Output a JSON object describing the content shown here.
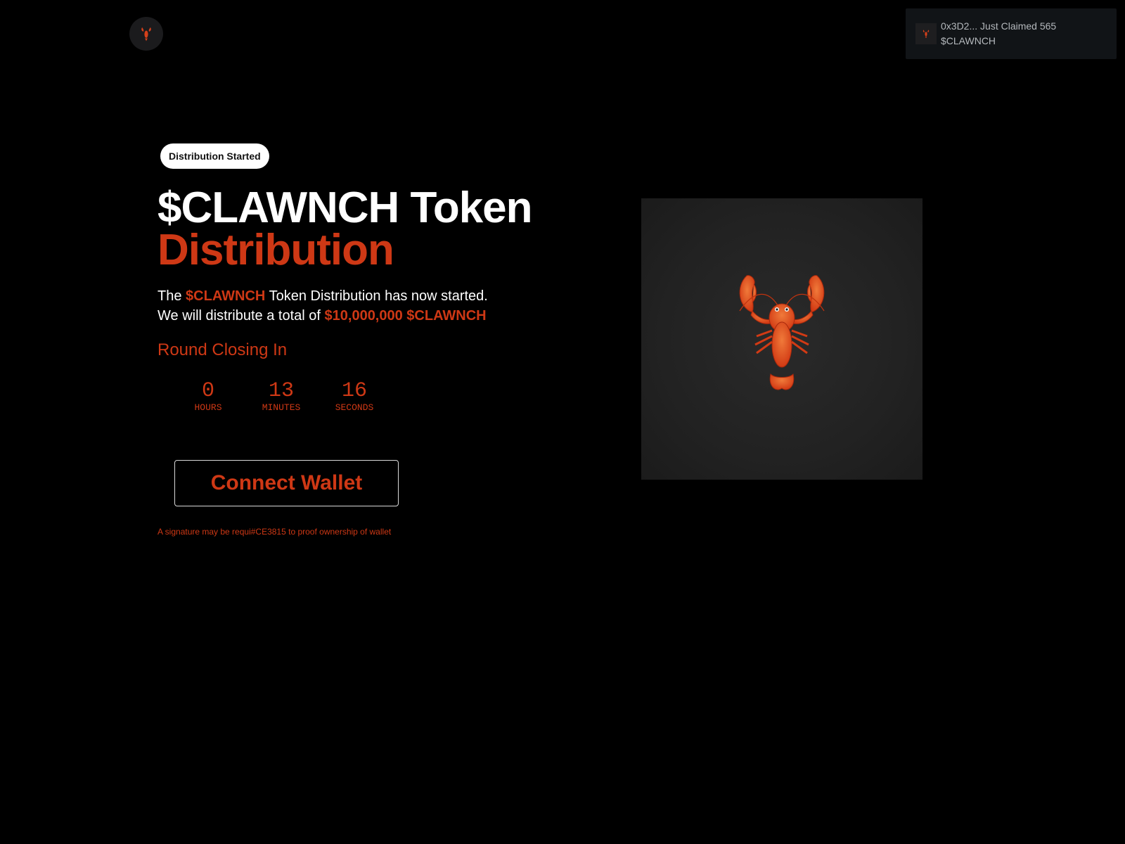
{
  "header": {
    "logo_icon": "lobster-icon"
  },
  "toast": {
    "icon": "lobster-icon",
    "line1": "0x3D2... Just Claimed 565",
    "line2": "$CLAWNCH"
  },
  "hero": {
    "badge": "Distribution Started",
    "title_line1": "$CLAWNCH Token",
    "title_line2": "Distribution",
    "desc_line1_prefix": "The ",
    "desc_line1_token": "$CLAWNCH",
    "desc_line1_suffix": " Token Distribution has now started.",
    "desc_line2_prefix": "We will distribute a total of ",
    "desc_line2_amount": "$10,000,000 $CLAWNCH",
    "round_label": "Round Closing In"
  },
  "countdown": {
    "hours": "0",
    "hours_label": "HOURS",
    "minutes": "13",
    "minutes_label": "MINUTES",
    "seconds": "16",
    "seconds_label": "SECONDS"
  },
  "actions": {
    "connect_label": "Connect Wallet",
    "signature_note": "A signature may be requi#CE3815 to proof ownership of wallet"
  },
  "image": {
    "icon": "lobster-icon"
  },
  "colors": {
    "accent": "#CE3815",
    "background": "#000000",
    "toast_bg": "#111417"
  }
}
